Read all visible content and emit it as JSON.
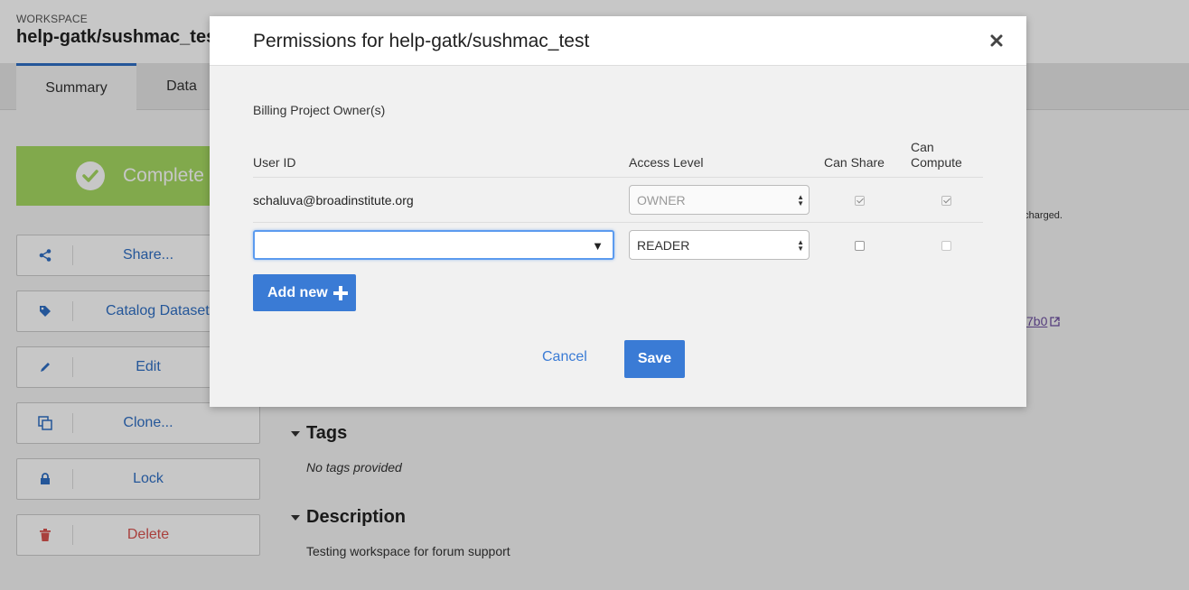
{
  "workspace": {
    "label": "WORKSPACE",
    "name": "help-gatk/sushmac_test"
  },
  "tabs": [
    {
      "label": "Summary",
      "active": true
    },
    {
      "label": "Data",
      "active": false
    }
  ],
  "sidebar": {
    "status": "Complete",
    "buttons": [
      {
        "label": "Share...",
        "icon": "share-icon"
      },
      {
        "label": "Catalog Dataset",
        "icon": "tag-icon"
      },
      {
        "label": "Edit",
        "icon": "pencil-icon"
      },
      {
        "label": "Clone...",
        "icon": "clone-icon"
      },
      {
        "label": "Lock",
        "icon": "lock-icon"
      },
      {
        "label": "Delete",
        "icon": "trash-icon"
      }
    ]
  },
  "main": {
    "charged_text": "e charged.",
    "link_fragment": "7b0",
    "tags_heading": "Tags",
    "tags_empty": "No tags provided",
    "description_heading": "Description",
    "description_text": "Testing workspace for forum support"
  },
  "modal": {
    "title": "Permissions for help-gatk/sushmac_test",
    "billing_label": "Billing Project Owner(s)",
    "columns": {
      "user_id": "User ID",
      "access_level": "Access Level",
      "can_share": "Can Share",
      "can_compute_line1": "Can",
      "can_compute_line2": "Compute"
    },
    "rows": [
      {
        "user": "schaluva@broadinstitute.org",
        "access": "OWNER",
        "can_share": true,
        "can_compute": true,
        "disabled": true
      },
      {
        "user": "",
        "access": "READER",
        "can_share": false,
        "can_compute": false,
        "disabled": false
      }
    ],
    "add_new_label": "Add new",
    "cancel_label": "Cancel",
    "save_label": "Save"
  },
  "colors": {
    "primary": "#3a7bd5",
    "status_green": "#a6d962",
    "danger": "#d9534f"
  }
}
